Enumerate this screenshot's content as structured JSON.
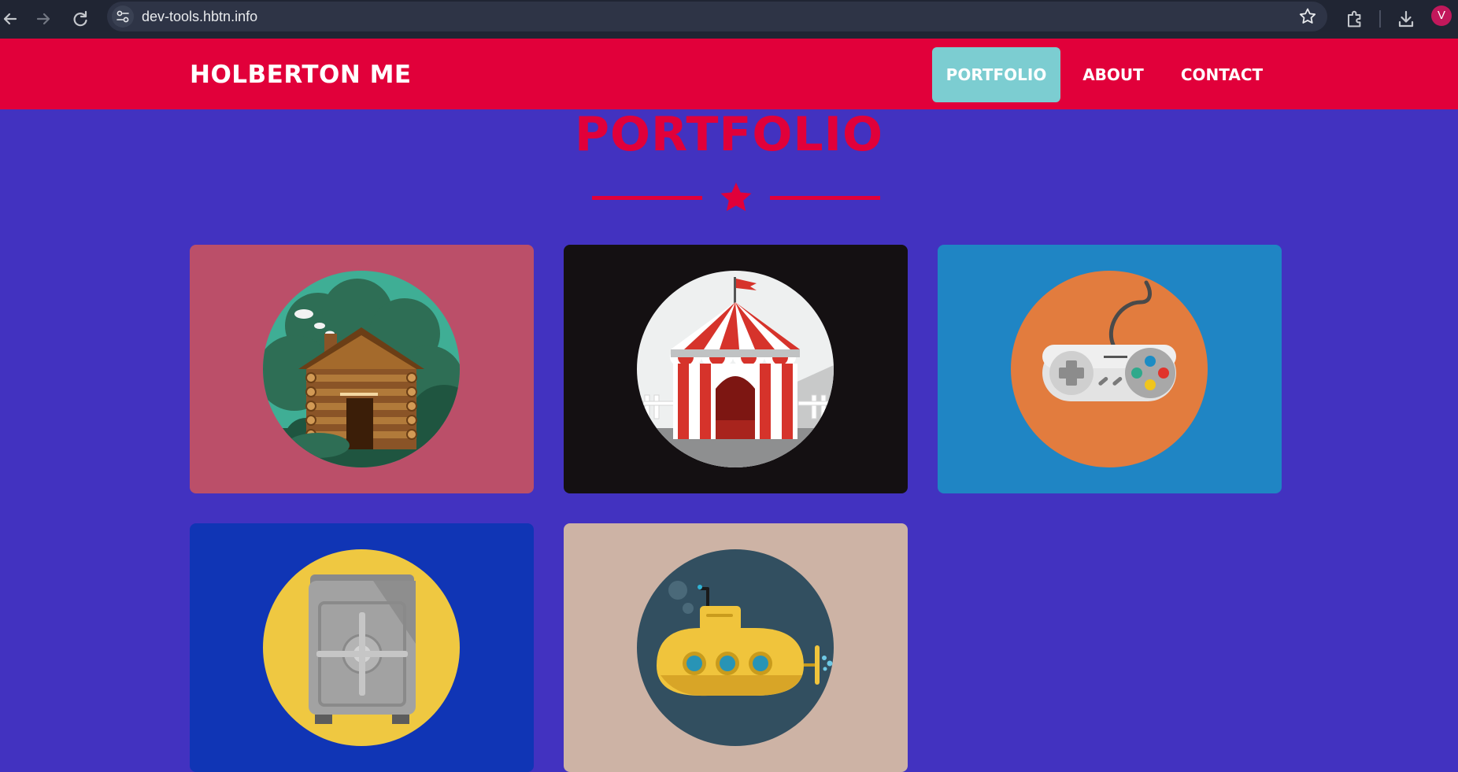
{
  "browser": {
    "url": "dev-tools.hbtn.info",
    "profile_initial": "V",
    "icons": [
      "back-arrow-icon",
      "forward-arrow-icon",
      "reload-icon",
      "site-info-icon",
      "bookmark-star-icon",
      "extensions-icon",
      "download-icon"
    ]
  },
  "site": {
    "brand": "HOLBERTON ME",
    "nav": [
      {
        "label": "PORTFOLIO",
        "active": true
      },
      {
        "label": "ABOUT",
        "active": false
      },
      {
        "label": "CONTACT",
        "active": false
      }
    ],
    "section_title": "PORTFOLIO",
    "colors": {
      "header": "#e1003a",
      "page_background": "#4232c0",
      "accent": "#e1003a",
      "active_nav": "#7ccdd1"
    }
  },
  "portfolio": [
    {
      "image": "log-cabin",
      "card_color": "#bb4f69",
      "circle_color": "#3fae95"
    },
    {
      "image": "circus-tent",
      "card_color": "#141012",
      "circle_color": "#eef0f0"
    },
    {
      "image": "game-controller",
      "card_color": "#1f85c4",
      "circle_color": "#e27c3e"
    },
    {
      "image": "safe",
      "card_color": "#1035b5",
      "circle_color": "#efc841"
    },
    {
      "image": "submarine",
      "card_color": "#cdb3a5",
      "circle_color": "#324f60"
    }
  ]
}
